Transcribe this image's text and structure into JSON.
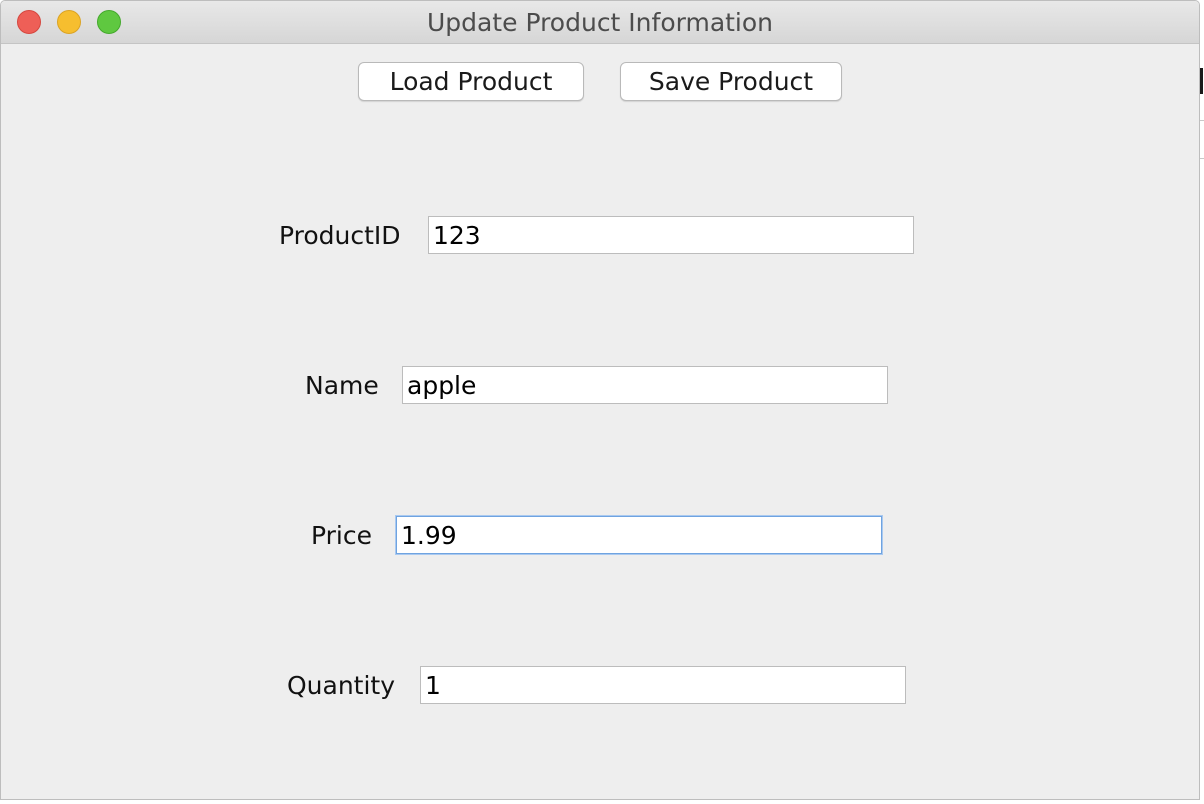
{
  "window": {
    "title": "Update Product Information"
  },
  "toolbar": {
    "load_label": "Load Product",
    "save_label": "Save Product"
  },
  "form": {
    "product_id": {
      "label": "ProductID",
      "value": "123"
    },
    "name": {
      "label": "Name",
      "value": "apple"
    },
    "price": {
      "label": "Price",
      "value": "1.99"
    },
    "quantity": {
      "label": "Quantity",
      "value": "1"
    }
  },
  "colors": {
    "close": "#ee5f57",
    "minimize": "#f6be2f",
    "zoom": "#5fc840",
    "focus_ring": "#6fa3e0",
    "window_bg": "#eeeeee"
  },
  "icons": {
    "close": "close-icon",
    "minimize": "minimize-icon",
    "zoom": "zoom-icon"
  }
}
